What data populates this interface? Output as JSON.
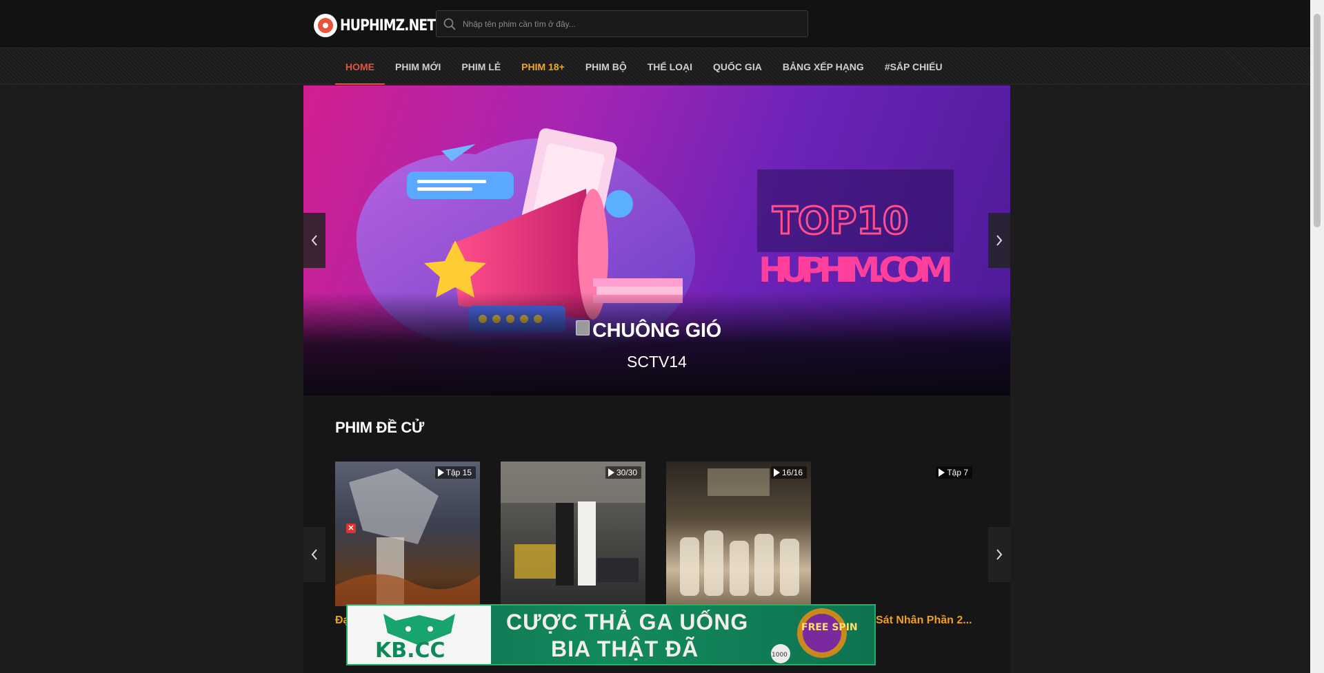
{
  "header": {
    "logo_text": "HUPHIMZ.NET",
    "search_placeholder": "Nhập tên phim cần tìm ở đây..."
  },
  "nav": {
    "items": [
      {
        "label": "HOME",
        "state": "active"
      },
      {
        "label": "PHIM MỚI"
      },
      {
        "label": "PHIM LẺ"
      },
      {
        "label": "PHIM 18+",
        "state": "highlight"
      },
      {
        "label": "PHIM BỘ"
      },
      {
        "label": "THỂ LOẠI"
      },
      {
        "label": "QUỐC GIA"
      },
      {
        "label": "BẢNG XẾP HẠNG"
      },
      {
        "label": "#SẮP CHIẾU"
      }
    ]
  },
  "slider": {
    "title": "CHUÔNG GIÓ",
    "subtitle": "SCTV14",
    "art_top_text": "TOP10",
    "art_bottom_text": "HUPHIM.COM"
  },
  "section": {
    "title": "PHIM ĐỀ CỬ"
  },
  "movies": [
    {
      "badge": "Tập 15",
      "title": "Đạ"
    },
    {
      "badge": "30/30",
      "title": ""
    },
    {
      "badge": "16/16",
      "title": ""
    },
    {
      "badge": "Tập 7",
      "title": "Sát Nhân Phần 2..."
    }
  ],
  "ad": {
    "logo_text": "KB.CC",
    "line1": "CƯỢC THẢ GA UỐNG",
    "line2": "BIA THẬT ĐÃ",
    "spin_text": "FREE SPIN",
    "chip_value": "1000"
  },
  "colors": {
    "accent": "#e8533a",
    "highlight": "#f5a623",
    "title_orange": "#f0a020",
    "ad_green": "#128a5e"
  },
  "icons": [
    "search-icon",
    "chevron-left-icon",
    "chevron-right-icon",
    "play-icon",
    "close-icon"
  ]
}
